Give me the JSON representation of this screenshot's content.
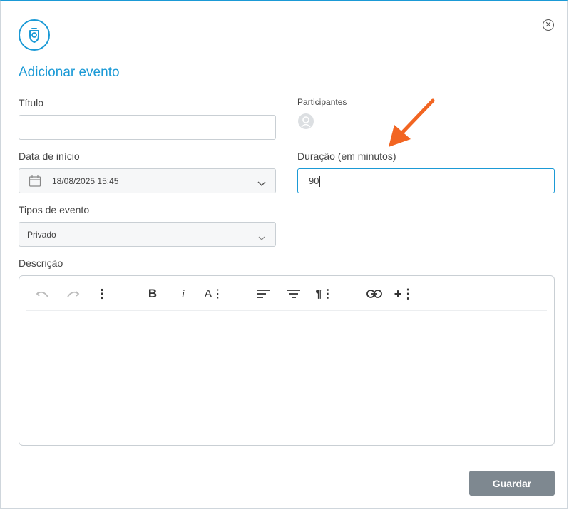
{
  "dialog": {
    "title": "Adicionar evento",
    "save_label": "Guardar"
  },
  "fields": {
    "titulo": {
      "label": "Título",
      "value": ""
    },
    "participantes": {
      "label": "Participantes"
    },
    "data_inicio": {
      "label": "Data de início",
      "value": "18/08/2025 15:45"
    },
    "duracao": {
      "label": "Duração (em minutos)",
      "value": "90"
    },
    "tipos_evento": {
      "label": "Tipos de evento",
      "selected": "Privado"
    },
    "descricao": {
      "label": "Descrição",
      "value": ""
    }
  },
  "editor_toolbar": {
    "bold_label": "B",
    "italic_label": "i",
    "font_label": "A⋮",
    "paragraph_label": "¶⋮",
    "insert_label": "+⋮"
  },
  "colors": {
    "accent": "#1b9ad6",
    "annotation_arrow": "#f26522",
    "save_button": "#7e8890"
  },
  "icons": [
    "close-icon",
    "app-logo-icon",
    "calendar-icon",
    "chevron-down-icon",
    "avatar-icon",
    "undo-icon",
    "redo-icon",
    "more-vertical-icon",
    "align-left-icon",
    "align-center-icon",
    "link-icon"
  ]
}
